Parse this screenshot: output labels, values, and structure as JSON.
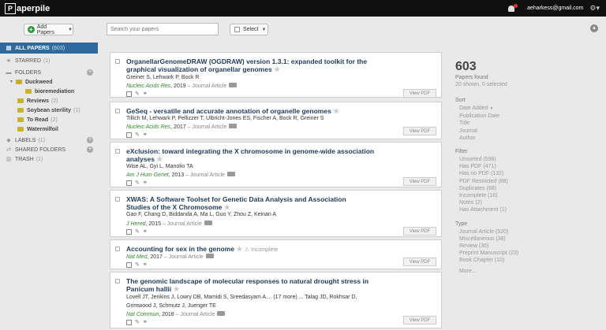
{
  "topbar": {
    "logo_text": "aperpile",
    "email": "aeharkess@gmail.com"
  },
  "toolbar": {
    "add_label": "Add Papers",
    "search_placeholder": "Search your papers",
    "select_label": "Select"
  },
  "sidebar": {
    "items": [
      {
        "label": "ALL PAPERS",
        "count": "(603)"
      },
      {
        "label": "STARRED",
        "count": "(1)"
      },
      {
        "label": "FOLDERS",
        "count": ""
      },
      {
        "label": "Duckweed",
        "count": ""
      },
      {
        "label": "bioremediation",
        "count": ""
      },
      {
        "label": "Reviews",
        "count": "(2)"
      },
      {
        "label": "Soybean sterility",
        "count": "(1)"
      },
      {
        "label": "To Read",
        "count": "(2)"
      },
      {
        "label": "Watermilfoil",
        "count": ""
      },
      {
        "label": "LABELS",
        "count": "(1)"
      },
      {
        "label": "SHARED FOLDERS",
        "count": ""
      },
      {
        "label": "TRASH",
        "count": "(1)"
      }
    ]
  },
  "papers": [
    {
      "title": "OrganellarGenomeDRAW (OGDRAW) version 1.3.1: expanded toolkit for the graphical visualization of organellar genomes",
      "authors": "Greiner S, Lehwark P, Bock R",
      "journal": "Nucleic Acids Res",
      "year": ", 2019",
      "type": " – Journal Article",
      "status": "",
      "view": "View PDF"
    },
    {
      "title": "GeSeq - versatile and accurate annotation of organelle genomes",
      "authors": "Tillich M, Lehwark P, Pellizzer T, Ulbricht-Jones ES, Fischer A, Bock R, Greiner S",
      "journal": "Nucleic Acids Res",
      "year": ", 2017",
      "type": " – Journal Article",
      "status": "",
      "view": "View PDF"
    },
    {
      "title": "eXclusion: toward integrating the X chromosome in genome-wide association analyses",
      "authors": "Wise AL, Gyi L, Manolio TA",
      "journal": "Am J Hum Genet",
      "year": ", 2013",
      "type": " – Journal Article",
      "status": "",
      "view": "View PDF"
    },
    {
      "title": "XWAS: A Software Toolset for Genetic Data Analysis and Association Studies of the X Chromosome",
      "authors": "Gao F, Chang D, Biddanda A, Ma L, Guo Y, Zhou Z, Keinan A",
      "journal": "J Hered",
      "year": ", 2015",
      "type": " – Journal Article",
      "status": "",
      "view": "View PDF"
    },
    {
      "title": "Accounting for sex in the genome",
      "authors": "",
      "journal": "Nat Med",
      "year": ", 2017",
      "type": " – Journal Article",
      "status": "Incomplete",
      "view": "View PDF"
    },
    {
      "title": "The genomic landscape of molecular responses to natural drought stress in Panicum hallii",
      "authors": "Lovell JT, Jenkins J, Lowry DB, Mamidi S, Sreedasyam A ... (17 more) ... Talag JD, Rokhsar D, Grimwood J, Schmutz J, Juenger TE",
      "journal": "Nat Commun",
      "year": ", 2018",
      "type": " – Journal Article",
      "status": "",
      "view": "View PDF"
    }
  ],
  "summary": {
    "count": "603",
    "found": "Papers found",
    "shown": "20 shown, 0 selected"
  },
  "sort": {
    "heading": "Sort",
    "items": [
      "Date Added",
      "Publication Date",
      "Title",
      "Journal",
      "Author"
    ]
  },
  "filter": {
    "heading": "Filter",
    "items": [
      "Unsorted (598)",
      "Has PDF (471)",
      "Has no PDF (132)",
      "PDF Restricted (88)",
      "Duplicates (88)",
      "Incomplete (16)",
      "Notes (2)",
      "Has Attachment (1)"
    ]
  },
  "type": {
    "heading": "Type",
    "items": [
      "Journal Article (520)",
      "Miscellaneous (38)",
      "Review (36)",
      "Preprint Manuscript (23)",
      "Book Chapter (10)"
    ]
  },
  "more": "More..."
}
